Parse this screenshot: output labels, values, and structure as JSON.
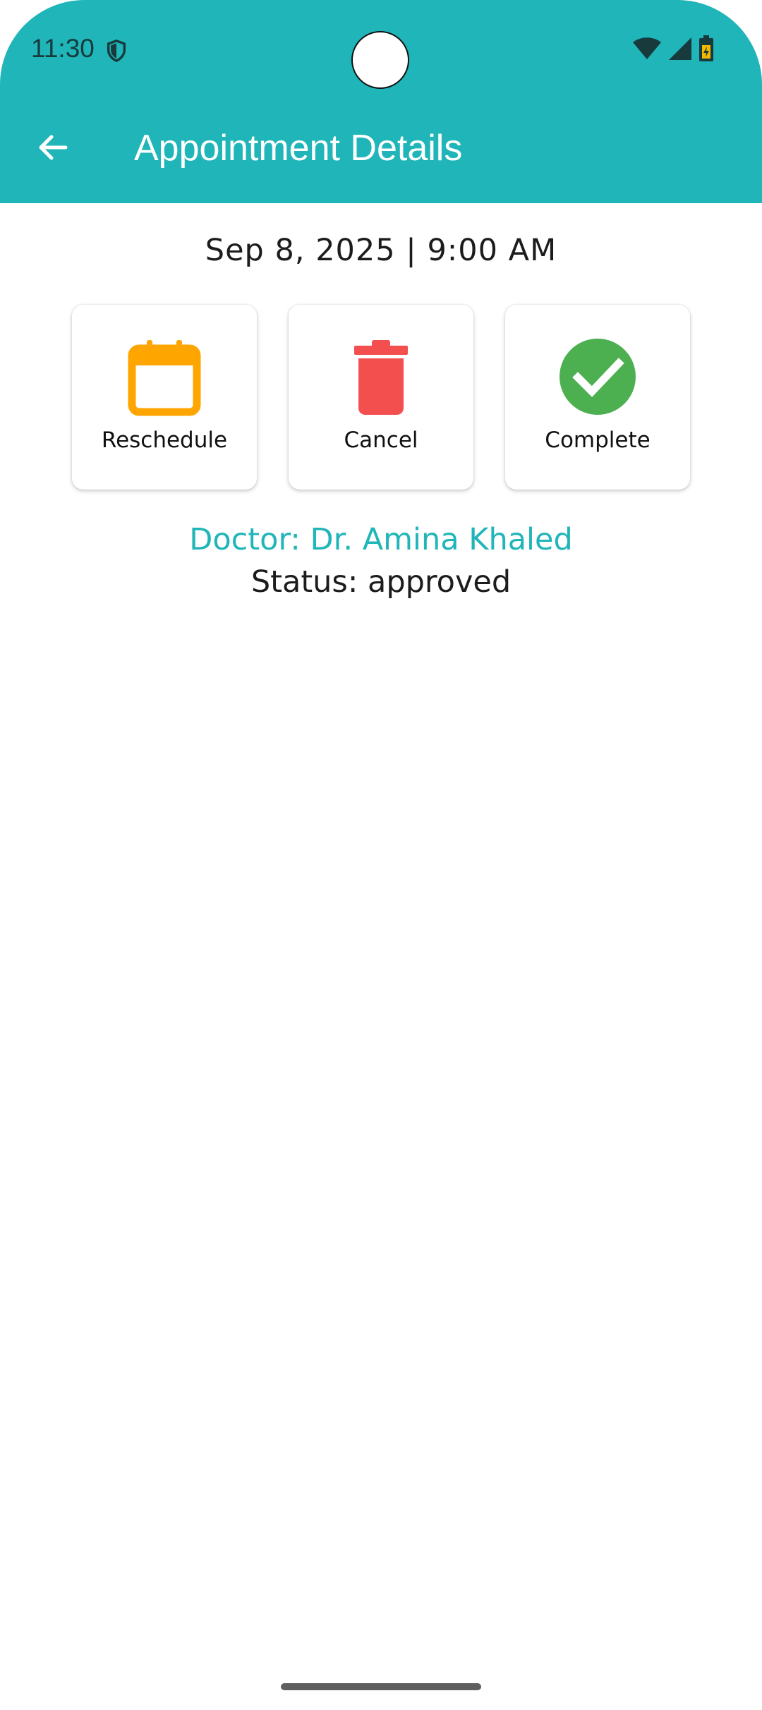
{
  "status_bar": {
    "time": "11:30"
  },
  "app_bar": {
    "title": "Appointment Details",
    "back_icon": "arrow-left-icon"
  },
  "appointment": {
    "datetime": "Sep 8, 2025 | 9:00 AM",
    "doctor": "Doctor: Dr. Amina Khaled",
    "status": "Status: approved"
  },
  "actions": [
    {
      "label": "Reschedule",
      "icon": "calendar-icon",
      "color": "#ffa500"
    },
    {
      "label": "Cancel",
      "icon": "trash-icon",
      "color": "#f44f4f"
    },
    {
      "label": "Complete",
      "icon": "check-circle-icon",
      "color": "#4caf50"
    }
  ],
  "colors": {
    "primary": "#20b5b8"
  }
}
